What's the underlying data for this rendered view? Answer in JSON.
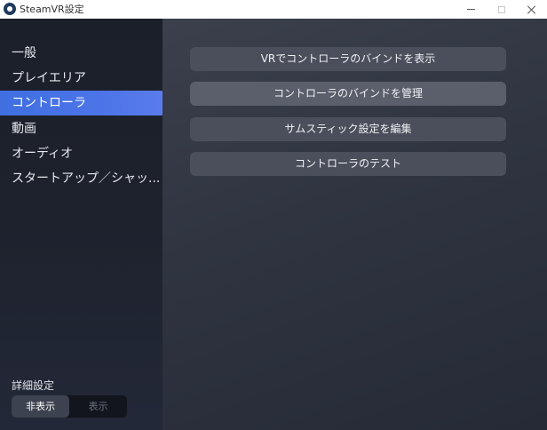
{
  "window": {
    "title": "SteamVR設定"
  },
  "sidebar": {
    "items": [
      {
        "label": "一般",
        "active": false
      },
      {
        "label": "プレイエリア",
        "active": false
      },
      {
        "label": "コントローラ",
        "active": true
      },
      {
        "label": "動画",
        "active": false
      },
      {
        "label": "オーディオ",
        "active": false
      },
      {
        "label": "スタートアップ／シャッ...",
        "active": false
      }
    ],
    "advanced": {
      "label": "詳細設定",
      "options": [
        "非表示",
        "表示"
      ],
      "selected": "非表示"
    }
  },
  "main": {
    "buttons": [
      {
        "label": "VRでコントローラのバインドを表示"
      },
      {
        "label": "コントローラのバインドを管理"
      },
      {
        "label": "サムスティック設定を編集"
      },
      {
        "label": "コントローラのテスト"
      }
    ]
  },
  "colors": {
    "accent": "#4c74e8",
    "sidebar_bg": "#1e222d",
    "main_bg": "#2f3440",
    "button_bg": "#4a4f5b"
  },
  "icons": {
    "app": "steamvr-icon",
    "minimize": "minimize-icon",
    "maximize": "maximize-icon",
    "close": "close-icon"
  }
}
